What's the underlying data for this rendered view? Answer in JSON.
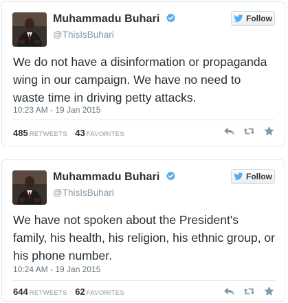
{
  "tweets": [
    {
      "name": "Muhammadu Buhari",
      "handle": "@ThisIsBuhari",
      "follow_label": "Follow",
      "text": "We do not have a disinformation or propaganda wing in our campaign. We have no need to waste time in driving petty attacks.",
      "date": "10:23 AM - 19 Jan 2015",
      "retweets": "485",
      "retweets_label": "RETWEETS",
      "favorites": "43",
      "favorites_label": "FAVORITES"
    },
    {
      "name": "Muhammadu Buhari",
      "handle": "@ThisIsBuhari",
      "follow_label": "Follow",
      "text": "We have not spoken about the President's family, his health, his religion, his ethnic group, or his phone number.",
      "date": "10:24 AM - 19 Jan 2015",
      "retweets": "644",
      "retweets_label": "RETWEETS",
      "favorites": "62",
      "favorites_label": "FAVORITES"
    }
  ],
  "icons": {
    "verified": "verified-badge-icon",
    "bird": "twitter-bird-icon",
    "reply": "reply-icon",
    "retweet": "retweet-icon",
    "favorite": "star-icon"
  },
  "colors": {
    "verified_blue": "#55acee",
    "bird_blue": "#55acee",
    "action_gray": "#8899a6",
    "text": "#292f33"
  }
}
